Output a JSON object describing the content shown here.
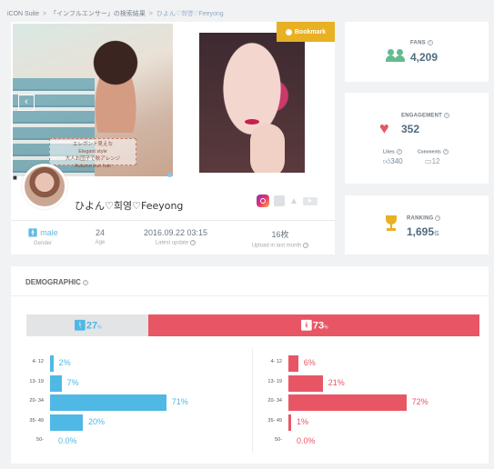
{
  "breadcrumb": {
    "root": "iCON Suite",
    "section": "「インフルエンサー」の検索結果",
    "current": "ひよん♡희영♡Feeyong",
    "separator": ">"
  },
  "profile": {
    "bookmark_label": "Bookmark",
    "name": "ひよん♡희영♡Feeyong",
    "prev_glyph": "‹",
    "photo_overlay": [
      "エレガント見えな",
      "Elegant style",
      "大人お団子で秋アレンジ",
      "Autumn bun hair"
    ],
    "stats": [
      {
        "value": "male",
        "label": "Gender"
      },
      {
        "value": "24",
        "label": "Age"
      },
      {
        "value": "2016.09.22 03:15",
        "label": "Latest update"
      },
      {
        "value": "16枚",
        "label": "Upload in last month"
      }
    ],
    "social_icons": [
      "instagram-icon",
      "facebook-icon",
      "twitter-icon",
      "youtube-icon"
    ]
  },
  "fans": {
    "label": "FANS",
    "value": "4,209"
  },
  "engagement": {
    "label": "ENGAGEMENT",
    "value": "352",
    "likes_label": "Likes",
    "likes_value": "340",
    "comments_label": "Comments",
    "comments_value": "12"
  },
  "ranking": {
    "label": "RANKING",
    "value": "1,695",
    "unit": "位"
  },
  "demographic": {
    "title": "DEMOGRAPHIC",
    "gender_split": {
      "male_pct": 27,
      "female_pct": 73,
      "male_label": "27",
      "female_label": "73",
      "unit": "%"
    },
    "age_groups": [
      "4- 12",
      "13- 19",
      "20- 34",
      "35- 49",
      "50-"
    ],
    "male_values": [
      2,
      7,
      71,
      20,
      0.0
    ],
    "male_labels": [
      "2%",
      "7%",
      "71%",
      "20%",
      "0.0%"
    ],
    "female_values": [
      6,
      21,
      72,
      1,
      0.0
    ],
    "female_labels": [
      "6%",
      "21%",
      "72%",
      "1%",
      "0.0%"
    ]
  },
  "colors": {
    "male": "#50b8e4",
    "female": "#e85665",
    "accent": "#e8b123"
  }
}
